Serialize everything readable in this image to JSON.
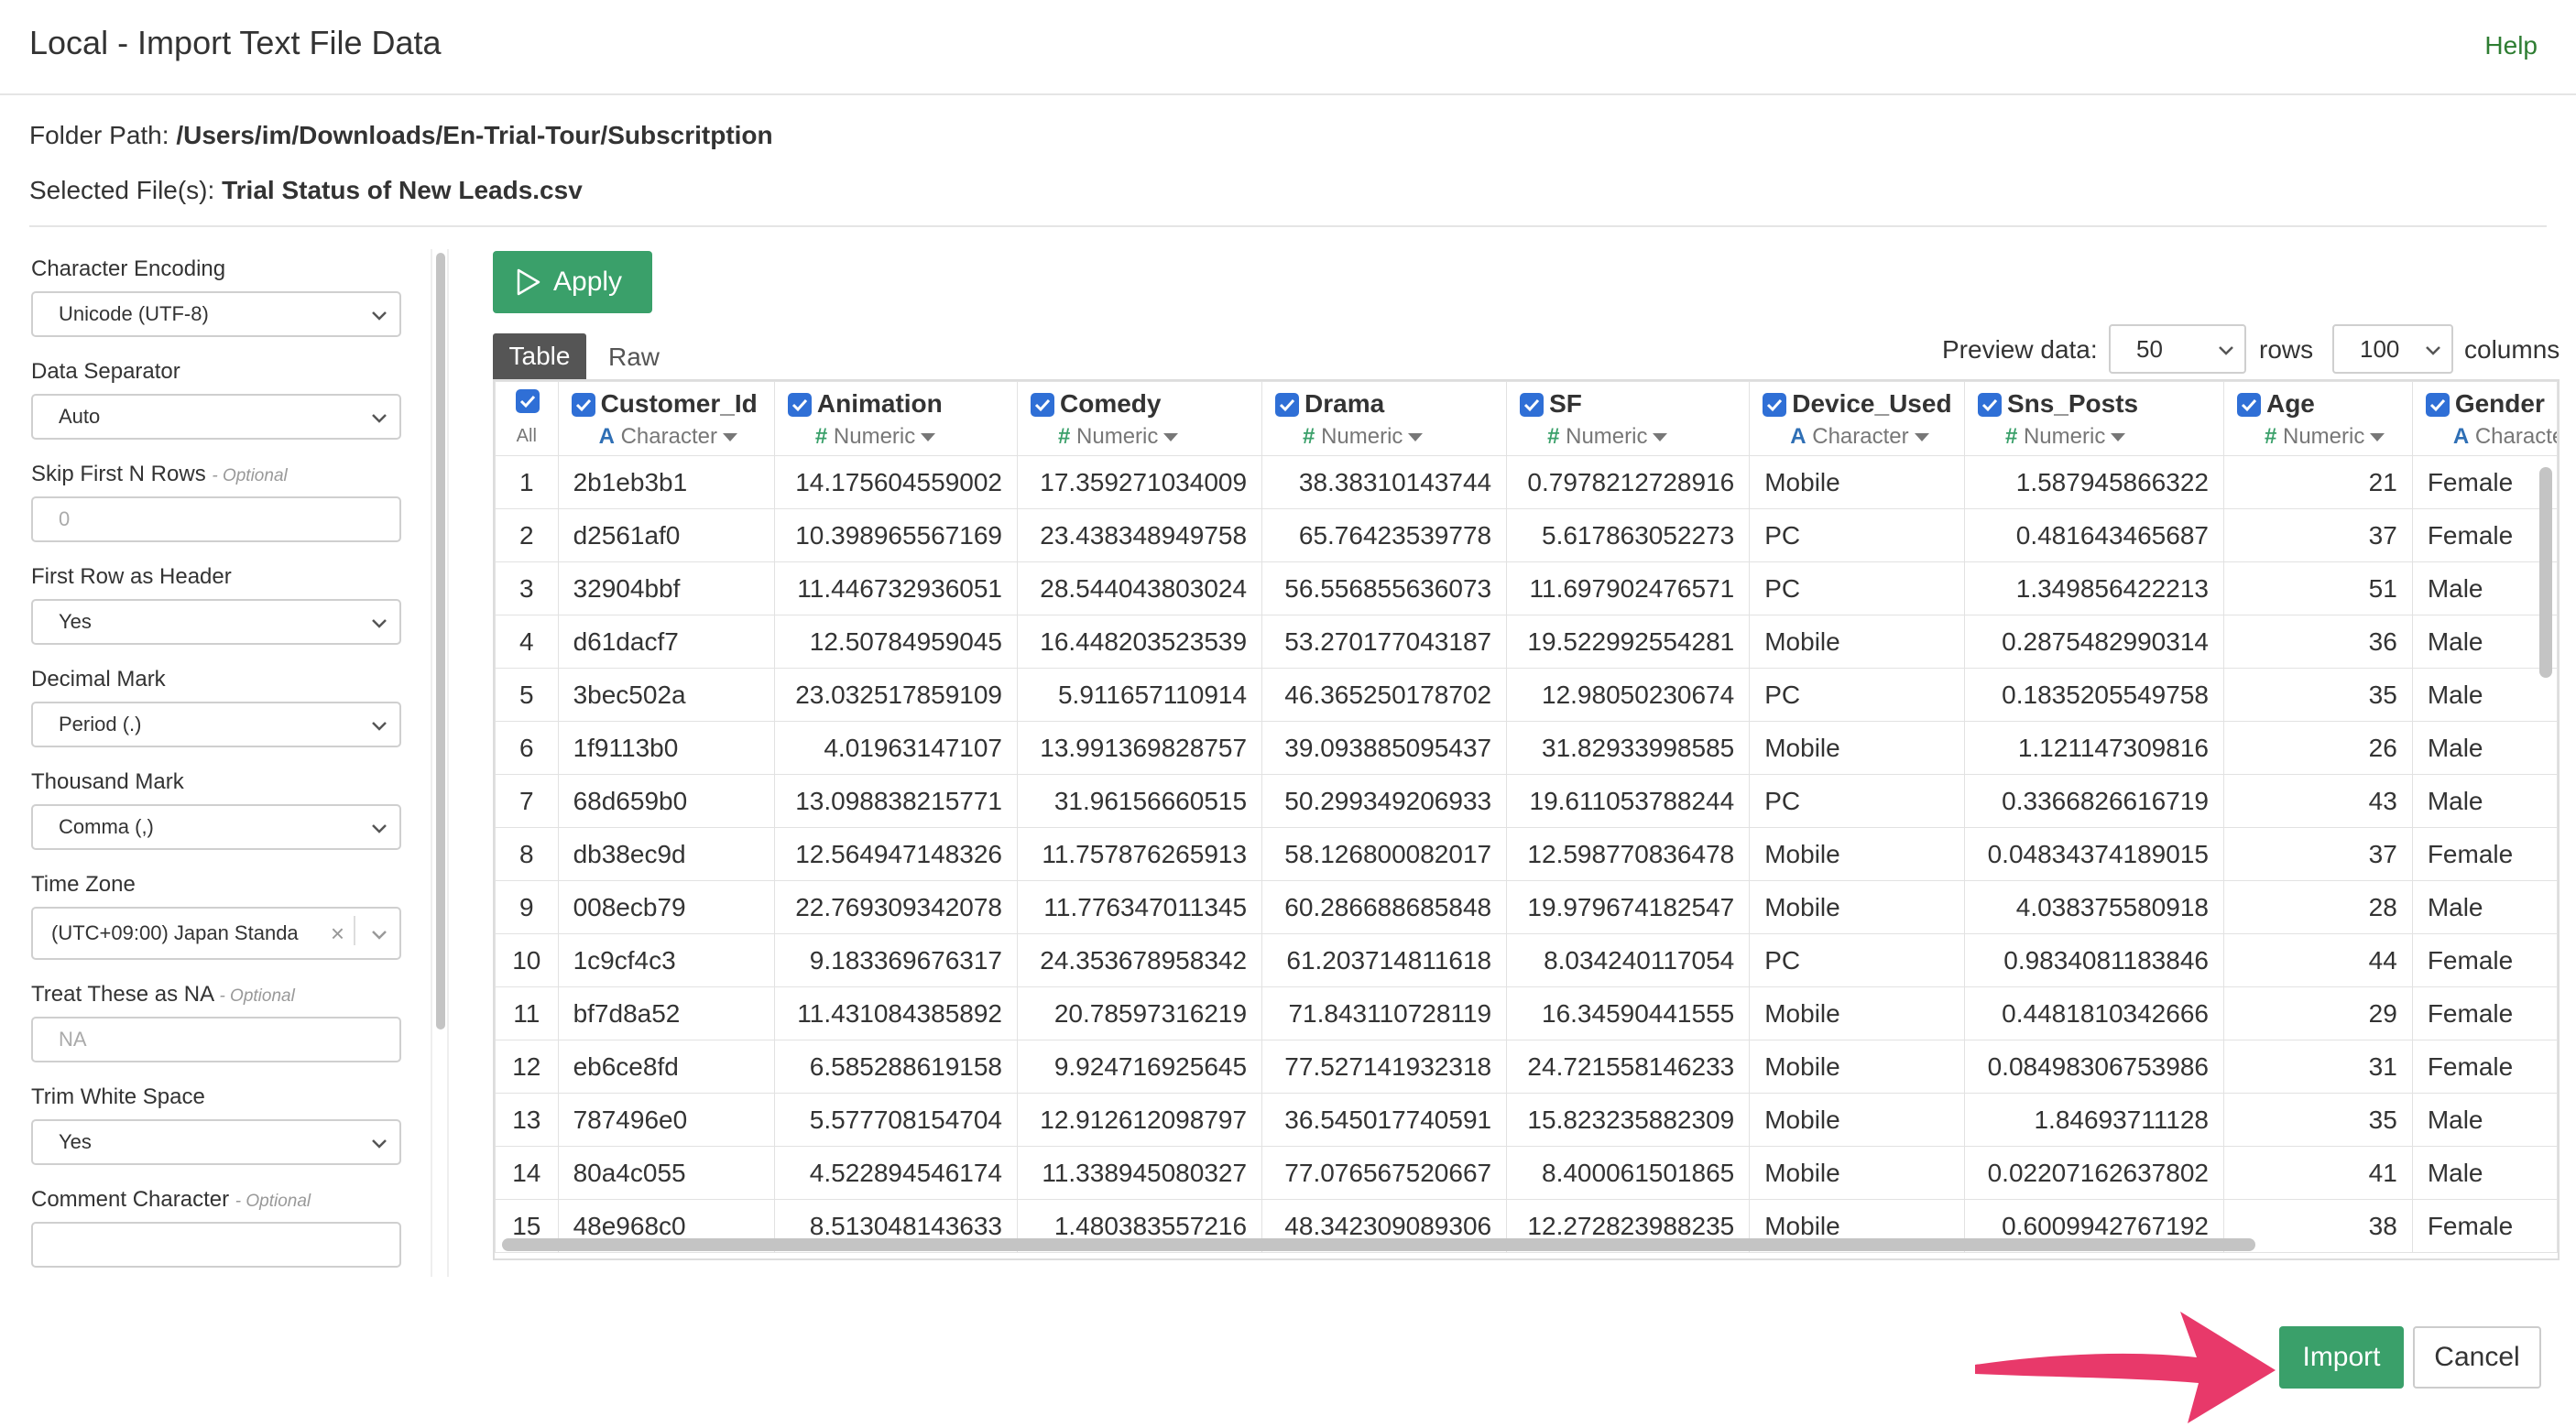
{
  "header": {
    "title": "Local - Import Text File Data",
    "help": "Help"
  },
  "info": {
    "folder_label": "Folder Path:",
    "folder_value": "/Users/im/Downloads/En-Trial-Tour/Subscritption",
    "file_label": "Selected File(s):",
    "file_value": "Trial Status of New Leads.csv"
  },
  "settings": {
    "encoding": {
      "label": "Character Encoding",
      "value": "Unicode (UTF-8)"
    },
    "separator": {
      "label": "Data Separator",
      "value": "Auto"
    },
    "skip": {
      "label": "Skip First N Rows",
      "optional": "- Optional",
      "placeholder": "0"
    },
    "header_row": {
      "label": "First Row as Header",
      "value": "Yes"
    },
    "decimal": {
      "label": "Decimal Mark",
      "value": "Period (.)"
    },
    "thousand": {
      "label": "Thousand Mark",
      "value": "Comma (,)"
    },
    "timezone": {
      "label": "Time Zone",
      "value": "(UTC+09:00) Japan Standa"
    },
    "na": {
      "label": "Treat These as NA",
      "optional": "- Optional",
      "placeholder": "NA"
    },
    "trim": {
      "label": "Trim White Space",
      "value": "Yes"
    },
    "comment": {
      "label": "Comment Character",
      "optional": "- Optional",
      "value": ""
    }
  },
  "toolbar": {
    "apply": "Apply",
    "tab_table": "Table",
    "tab_raw": "Raw",
    "preview_label": "Preview data:",
    "rows_value": "50",
    "rows_label": "rows",
    "cols_value": "100",
    "cols_label": "columns"
  },
  "table": {
    "all_label": "All",
    "columns": [
      {
        "name": "Customer_Id",
        "type_icon": "A",
        "type": "Character"
      },
      {
        "name": "Animation",
        "type_icon": "#",
        "type": "Numeric"
      },
      {
        "name": "Comedy",
        "type_icon": "#",
        "type": "Numeric"
      },
      {
        "name": "Drama",
        "type_icon": "#",
        "type": "Numeric"
      },
      {
        "name": "SF",
        "type_icon": "#",
        "type": "Numeric"
      },
      {
        "name": "Device_Used",
        "type_icon": "A",
        "type": "Character"
      },
      {
        "name": "Sns_Posts",
        "type_icon": "#",
        "type": "Numeric"
      },
      {
        "name": "Age",
        "type_icon": "#",
        "type": "Numeric"
      },
      {
        "name": "Gender",
        "type_icon": "A",
        "type": "Character"
      }
    ],
    "rows": [
      [
        "1",
        "2b1eb3b1",
        "14.175604559002",
        "17.359271034009",
        "38.38310143744",
        "0.7978212728916",
        "Mobile",
        "1.587945866322",
        "21",
        "Female"
      ],
      [
        "2",
        "d2561af0",
        "10.398965567169",
        "23.438348949758",
        "65.76423539778",
        "5.617863052273",
        "PC",
        "0.481643465687",
        "37",
        "Female"
      ],
      [
        "3",
        "32904bbf",
        "11.446732936051",
        "28.544043803024",
        "56.556855636073",
        "11.697902476571",
        "PC",
        "1.349856422213",
        "51",
        "Male"
      ],
      [
        "4",
        "d61dacf7",
        "12.50784959045",
        "16.448203523539",
        "53.270177043187",
        "19.522992554281",
        "Mobile",
        "0.2875482990314",
        "36",
        "Male"
      ],
      [
        "5",
        "3bec502a",
        "23.032517859109",
        "5.911657110914",
        "46.365250178702",
        "12.98050230674",
        "PC",
        "0.1835205549758",
        "35",
        "Male"
      ],
      [
        "6",
        "1f9113b0",
        "4.01963147107",
        "13.991369828757",
        "39.093885095437",
        "31.82933998585",
        "Mobile",
        "1.121147309816",
        "26",
        "Male"
      ],
      [
        "7",
        "68d659b0",
        "13.098838215771",
        "31.96156660515",
        "50.299349206933",
        "19.611053788244",
        "PC",
        "0.3366826616719",
        "43",
        "Male"
      ],
      [
        "8",
        "db38ec9d",
        "12.564947148326",
        "11.757876265913",
        "58.126800082017",
        "12.598770836478",
        "Mobile",
        "0.04834374189015",
        "37",
        "Female"
      ],
      [
        "9",
        "008ecb79",
        "22.769309342078",
        "11.776347011345",
        "60.286688685848",
        "19.979674182547",
        "Mobile",
        "4.038375580918",
        "28",
        "Male"
      ],
      [
        "10",
        "1c9cf4c3",
        "9.183369676317",
        "24.353678958342",
        "61.203714811618",
        "8.034240117054",
        "PC",
        "0.9834081183846",
        "44",
        "Female"
      ],
      [
        "11",
        "bf7d8a52",
        "11.431084385892",
        "20.78597316219",
        "71.843110728119",
        "16.34590441555",
        "Mobile",
        "0.4481810342666",
        "29",
        "Female"
      ],
      [
        "12",
        "eb6ce8fd",
        "6.585288619158",
        "9.924716925645",
        "77.527141932318",
        "24.721558146233",
        "Mobile",
        "0.08498306753986",
        "31",
        "Female"
      ],
      [
        "13",
        "787496e0",
        "5.577708154704",
        "12.912612098797",
        "36.545017740591",
        "15.823235882309",
        "Mobile",
        "1.84693711128",
        "35",
        "Male"
      ],
      [
        "14",
        "80a4c055",
        "4.522894546174",
        "11.338945080327",
        "77.076567520667",
        "8.400061501865",
        "Mobile",
        "0.02207162637802",
        "41",
        "Male"
      ],
      [
        "15",
        "48e968c0",
        "8.513048143633",
        "1.480383557216",
        "48.342309089306",
        "12.272823988235",
        "Mobile",
        "0.6009942767192",
        "38",
        "Female"
      ]
    ]
  },
  "footer": {
    "import": "Import",
    "cancel": "Cancel"
  },
  "colors": {
    "accent_green": "#3aa06a",
    "checkbox_blue": "#2f6fd6",
    "arrow_pink": "#e8396a"
  }
}
